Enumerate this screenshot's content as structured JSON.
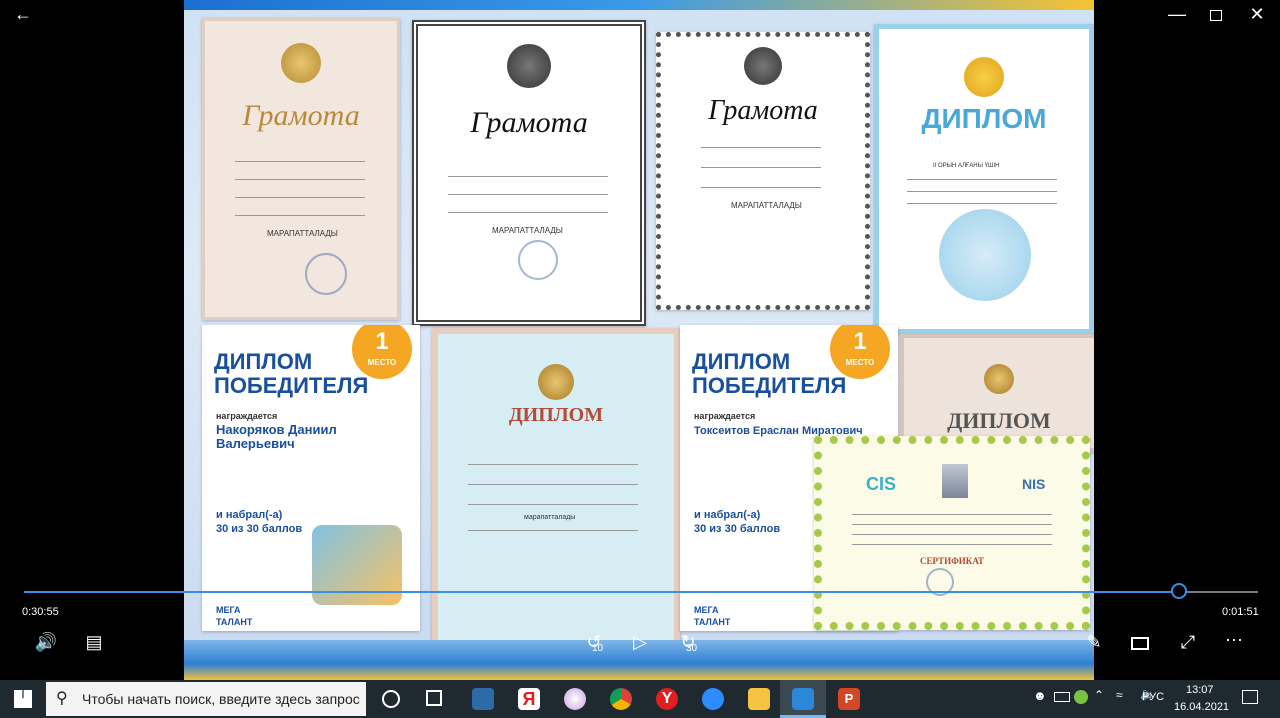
{
  "player": {
    "back_icon": "arrow-left-icon",
    "current_time": "0:30:55",
    "remaining_time": "0:01:51",
    "progress": 0.937,
    "skip_back_label": "10",
    "skip_forward_label": "30"
  },
  "certificates": [
    {
      "title": "Грамота",
      "text_bottom": "МАРАПАТТАЛАДЫ"
    },
    {
      "title": "Грамота",
      "text_bottom": "МАРАПАТТАЛАДЫ"
    },
    {
      "title": "Грамота",
      "text_bottom": "МАРАПАТТАЛАДЫ"
    },
    {
      "title": "ДИПЛОМ",
      "subtitle": "II ОРЫН АЛҒАНЫ ҮШІН"
    },
    {
      "title_line1": "ДИПЛОМ",
      "title_line2": "ПОБЕДИТЕЛЯ",
      "badge_num": "1",
      "badge_text": "МЕСТО",
      "awarded": "награждается",
      "name": "Накоряков Даниил Валерьевич",
      "score_intro": "и набрал(-а)",
      "score": "30 из 30 баллов",
      "brand1": "МЕГА",
      "brand2": "ТАЛАНТ"
    },
    {
      "title": "ДИПЛОМ",
      "text_bottom": "марапатталады"
    },
    {
      "title_line1": "ДИПЛОМ",
      "title_line2": "ПОБЕДИТЕЛЯ",
      "badge_num": "1",
      "badge_text": "МЕСТО",
      "awarded": "награждается",
      "name": "Токсеитов Ераслан Миратович",
      "score_intro": "и набрал(-а)",
      "score": "30 из 30 баллов",
      "brand1": "МЕГА",
      "brand2": "ТАЛАНТ"
    },
    {
      "title": "ДИПЛОМ"
    },
    {
      "logo_left": "CIS",
      "logo_right": "NIS",
      "title": "СЕРТИФИКАТ"
    }
  ],
  "taskbar": {
    "search_placeholder": "Чтобы начать поиск, введите здесь запрос",
    "language": "РУС",
    "time": "13:07",
    "date": "16.04.2021"
  },
  "colors": {
    "accent": "#3a8ee6",
    "taskbar": "#1f2a30",
    "diploma_blue": "#1a4f9c",
    "badge": "#f5a623"
  }
}
